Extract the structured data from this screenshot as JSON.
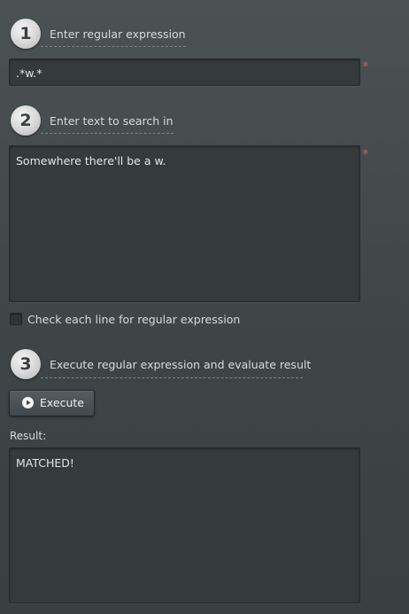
{
  "steps": {
    "one": {
      "number": "1",
      "title": "Enter regular expression"
    },
    "two": {
      "number": "2",
      "title": "Enter text to search in"
    },
    "three": {
      "number": "3",
      "title": "Execute regular expression and evaluate result"
    }
  },
  "regex_input": {
    "value": ".*w.*",
    "required_mark": "*"
  },
  "search_text": {
    "value": "Somewhere there'll be a w.",
    "required_mark": "*"
  },
  "each_line_option": {
    "label": "Check each line for regular expression",
    "checked": false
  },
  "execute_button": {
    "label": "Execute",
    "icon": "play-circle-icon"
  },
  "result": {
    "label": "Result:",
    "value": "MATCHED!"
  },
  "colors": {
    "background": "#434a4c",
    "required": "#d9534f",
    "field": "#353a3c"
  }
}
